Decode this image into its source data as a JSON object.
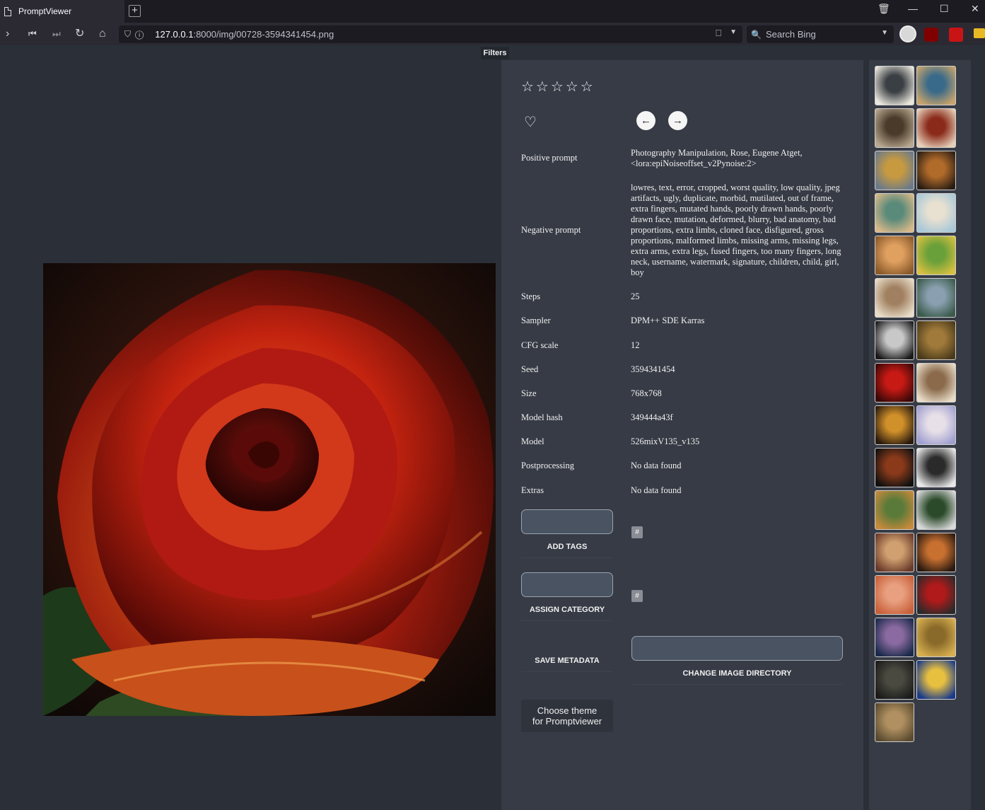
{
  "browser": {
    "tab_title": "PromptViewer",
    "url_host": "127.0.0.1",
    "url_path": ":8000/img/00728-3594341454.png",
    "search_placeholder": "Search Bing"
  },
  "app": {
    "filters_label": "Filters",
    "rating": {
      "value": 0,
      "max": 5,
      "stars": "☆☆☆☆☆"
    },
    "heart_glyph": "♡",
    "prev_glyph": "←",
    "next_glyph": "→",
    "metadata": [
      {
        "label": "Positive prompt",
        "value": "Photography Manipulation, Rose, Eugene Atget, <lora:epiNoiseoffset_v2Pynoise:2>"
      },
      {
        "label": "Negative prompt",
        "value": "lowres, text, error, cropped, worst quality, low quality, jpeg artifacts, ugly, duplicate, morbid, mutilated, out of frame, extra fingers, mutated hands, poorly drawn hands, poorly drawn face, mutation, deformed, blurry, bad anatomy, bad proportions, extra limbs, cloned face, disfigured, gross proportions, malformed limbs, missing arms, missing legs, extra arms, extra legs, fused fingers, too many fingers, long neck, username, watermark, signature, children, child, girl, boy"
      },
      {
        "label": "Steps",
        "value": "25"
      },
      {
        "label": "Sampler",
        "value": "DPM++ SDE Karras"
      },
      {
        "label": "CFG scale",
        "value": "12"
      },
      {
        "label": "Seed",
        "value": "3594341454"
      },
      {
        "label": "Size",
        "value": "768x768"
      },
      {
        "label": "Model hash",
        "value": "349444a43f"
      },
      {
        "label": "Model",
        "value": "526mixV135_v135"
      },
      {
        "label": "Postprocessing",
        "value": "No data found"
      },
      {
        "label": "Extras",
        "value": "No data found"
      }
    ],
    "add_tags_label": "ADD TAGS",
    "assign_category_label": "ASSIGN CATEGORY",
    "hash_chip": "#",
    "save_metadata_label": "SAVE METADATA",
    "change_dir_label": "CHANGE IMAGE DIRECTORY",
    "theme_button_line1": "Choose theme",
    "theme_button_line2": "for Promptviewer"
  },
  "colors": {
    "page_bg": "#2b3038",
    "panel_bg": "#363b45",
    "input_bg": "#4a5361",
    "rose_red": "#b01a12",
    "rose_orange": "#e0601a"
  },
  "thumbnails": [
    "glass-dome-landscape",
    "pearl-earring-painting",
    "ornate-spiral-sculpture",
    "woman-portrait-hat",
    "seascape-painting",
    "mona-lisa-color",
    "building-street",
    "glass-globe",
    "renaissance-couple",
    "colorful-hills",
    "palace-hall",
    "mountain-lake",
    "drinks-glasses",
    "mona-lisa",
    "red-rose",
    "cathedral-arches",
    "beer-glasses",
    "lavender-field",
    "whiskey-glass",
    "framed-flowers",
    "autumn-landscape",
    "green-sphere",
    "colosseum",
    "fireplace-room",
    "red-building",
    "red-rose-dark",
    "woman-flower-hat",
    "wheat-field",
    "still-life-candle",
    "starry-night",
    "autumn-park"
  ]
}
